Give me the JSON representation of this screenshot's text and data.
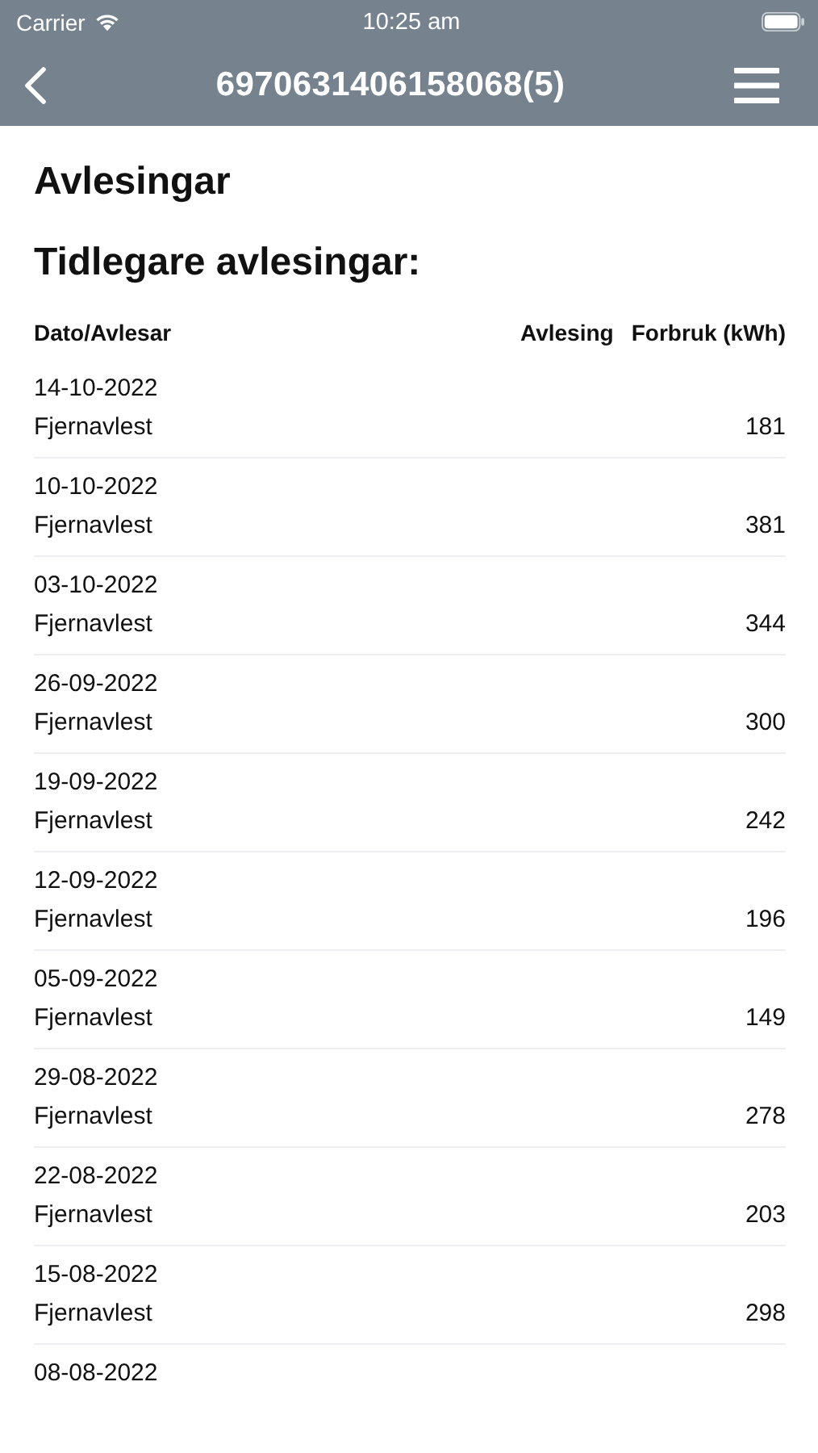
{
  "status_bar": {
    "carrier": "Carrier",
    "time": "10:25 am"
  },
  "nav_bar": {
    "title": "6970631406158068(5)"
  },
  "page_title": "Avlesingar",
  "section_title": "Tidlegare avlesingar:",
  "table": {
    "columns": [
      "Dato/Avlesar",
      "Avlesing",
      "Forbruk (kWh)"
    ],
    "rows": [
      {
        "date": "14-10-2022",
        "reader": "Fjernavlest",
        "consumption": "181"
      },
      {
        "date": "10-10-2022",
        "reader": "Fjernavlest",
        "consumption": "381"
      },
      {
        "date": "03-10-2022",
        "reader": "Fjernavlest",
        "consumption": "344"
      },
      {
        "date": "26-09-2022",
        "reader": "Fjernavlest",
        "consumption": "300"
      },
      {
        "date": "19-09-2022",
        "reader": "Fjernavlest",
        "consumption": "242"
      },
      {
        "date": "12-09-2022",
        "reader": "Fjernavlest",
        "consumption": "196"
      },
      {
        "date": "05-09-2022",
        "reader": "Fjernavlest",
        "consumption": "149"
      },
      {
        "date": "29-08-2022",
        "reader": "Fjernavlest",
        "consumption": "278"
      },
      {
        "date": "22-08-2022",
        "reader": "Fjernavlest",
        "consumption": "203"
      },
      {
        "date": "15-08-2022",
        "reader": "Fjernavlest",
        "consumption": "298"
      },
      {
        "date": "08-08-2022"
      }
    ]
  }
}
